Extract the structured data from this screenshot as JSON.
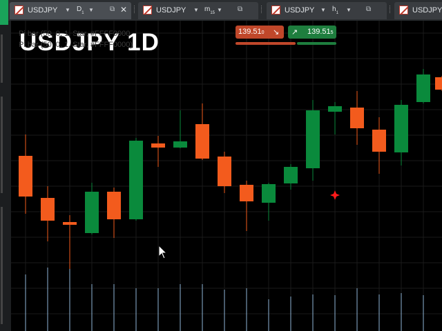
{
  "tabs": [
    {
      "symbol": "USDJPY",
      "timeframe": "D",
      "timeframe_sub": "1",
      "active": true,
      "closable": true
    },
    {
      "symbol": "USDJPY",
      "timeframe": "m",
      "timeframe_sub": "15",
      "active": false,
      "closable": false
    },
    {
      "symbol": "USDJPY",
      "timeframe": "h",
      "timeframe_sub": "1",
      "active": false,
      "closable": false
    },
    {
      "symbol": "USDJPY",
      "timeframe": "",
      "timeframe_sub": "",
      "active": false,
      "closable": false
    }
  ],
  "chart": {
    "watermark": "USDJPY 1D",
    "info_line1": "Pi bar (50, 0, 1, Star, #FFFF0000",
    "info_line2": "Pi bar (50, 0, 1, Star, #FFFF0000)"
  },
  "trade": {
    "sell_price": "139.51",
    "sell_digit": "0",
    "buy_price": "139.51",
    "buy_digit": "5",
    "sell_color": "#c0472a",
    "buy_color": "#1e7e3e"
  },
  "chart_data": {
    "type": "candlestick",
    "bull_color": "#0a8a3c",
    "bear_color": "#f35b1d",
    "candles": [
      {
        "o": 1,
        "h": 1,
        "l": 1,
        "c": 1,
        "dir": "bear"
      }
    ]
  },
  "icons": {
    "dropdown": "chevron-down-icon",
    "popout": "popout-icon",
    "close": "close-icon",
    "sell": "arrow-down-right-icon",
    "buy": "arrow-up-right-icon",
    "star": "star-marker-icon",
    "cursor": "mouse-pointer-icon"
  }
}
